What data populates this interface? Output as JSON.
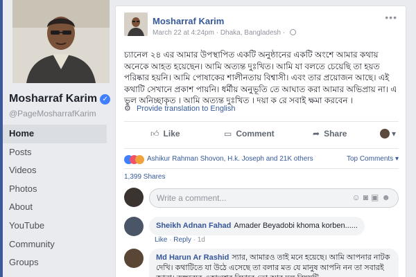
{
  "sidebar": {
    "name": "Mosharraf Karim",
    "handle": "@PageMosharrafKarim",
    "nav": [
      "Home",
      "Posts",
      "Videos",
      "Photos",
      "About",
      "YouTube",
      "Community",
      "Groups"
    ]
  },
  "post": {
    "author": "Mosharraf Karim",
    "date": "March 22 at 4:24pm",
    "location": "Dhaka, Bangladesh",
    "text": "চ্যানেল ২৪ এর আমার উপস্থাপিত একটি অনুষ্ঠানের একটি অংশে আমার কথায় অনেকে আহত হয়েছেন। আমি অত্যন্ত দুঃখিত। আমি যা বলতে চেয়েছি তা হয়ত পরিষ্কার হয়নি। আমি পোষাকের শালীনতায় বিশ্বাসী। এবং তার প্রয়োজন আছে। এই কথাটি সেখানে প্রকাশ পায়নি। ধর্মীয় অনুভূতি তে আঘাত করা আমার অভিপ্রায় না। এ ভুল অনিচ্ছাকৃত । আমি অত্যন্ত দুঃখিত । দয়া ক রে সবাই ক্ষমা করবেন ।",
    "translate": "Provide translation to English",
    "actions": {
      "like": "Like",
      "comment": "Comment",
      "share": "Share"
    },
    "reactions_text": "Ashikur Rahman Shovon, H.k. Joseph and 21K others",
    "top_comments": "Top Comments",
    "shares": "1,399 Shares",
    "comment_placeholder": "Write a comment...",
    "comments": [
      {
        "author": "Sheikh Adnan Fahad",
        "text": "Amader Beyadobi khoma korben......",
        "like": "Like",
        "reply": "Reply",
        "time": "1d"
      },
      {
        "author": "Md Harun Ar Rashid",
        "text": "স্যার, আমারও তাই মনে হয়েছে। আমি আপনার নাটক দেখি। কথাটিতে যা উঠে এসেছে তা বলার মত যে মানুষ আপনি নন তা সবারই জানা। বক্তব্যের একাংশের বিচারে তো আর মূল বিষয়টি"
      }
    ]
  },
  "colors": {
    "brand": "#3b5998",
    "link": "#365899",
    "background": "#e9ebee"
  }
}
